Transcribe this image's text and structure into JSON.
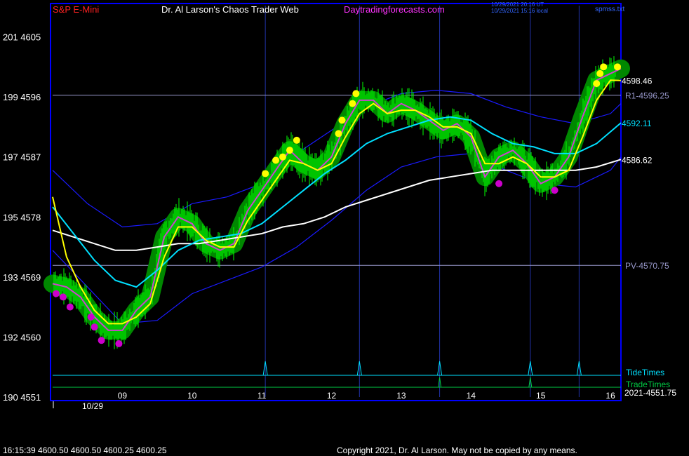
{
  "header": {
    "symbol": "S&P E-Mini",
    "site": "Dr. Al Larson's Chaos Trader Web",
    "url": "Daytradingforecasts.com",
    "utc_time": "10/29/2021 20:16 UT",
    "local_time": "10/29/2021 15:16 local",
    "file": "spmss.txt"
  },
  "footer": {
    "quote": "16:15:39  4600.50 4600.50 4600.25 4600.25",
    "copyright": "Copyright 2021, Dr. Al Larson. May not be copied by any means."
  },
  "colors": {
    "background": "#000000",
    "frame": "#0000ff",
    "price_bars": "#00ff00",
    "highlight": "#008800",
    "fast_ma": "#ffff00",
    "inner_line": "#cc44cc",
    "cyan_ma": "#00e0ff",
    "white_ma": "#ffffff",
    "band": "#1a1aff",
    "tide": "#00e0ff",
    "trade": "#00cc44",
    "level_line": "#9999cc",
    "yellow_dot": "#ffff00",
    "magenta_dot": "#cc00cc"
  },
  "chart_data": {
    "type": "line",
    "title": "S&P E-Mini",
    "x_tick_labels": [
      "09",
      "10",
      "11",
      "12",
      "13",
      "14",
      "15",
      "16"
    ],
    "date_label": "10/29",
    "y_axis": {
      "range": [
        4551,
        4610
      ],
      "ticks": [
        {
          "label": "201  4605",
          "value": 4605
        },
        {
          "label": "199  4596",
          "value": 4596
        },
        {
          "label": "197  4587",
          "value": 4587
        },
        {
          "label": "195  4578",
          "value": 4578
        },
        {
          "label": "193  4569",
          "value": 4569
        },
        {
          "label": "192  4560",
          "value": 4560
        },
        {
          "label": "190  4551",
          "value": 4551
        }
      ]
    },
    "levels": [
      {
        "label": "R1-4596.25",
        "value": 4596.25
      },
      {
        "label": "PV-4570.75",
        "value": 4570.75
      }
    ],
    "right_labels": [
      {
        "text": "4598.46",
        "value": 4598.46,
        "color": "#ffffff"
      },
      {
        "text": "4592.11",
        "value": 4592.11,
        "color": "#00e0ff"
      },
      {
        "text": "4586.62",
        "value": 4586.62,
        "color": "#ffffff"
      }
    ],
    "bottom_right_label": "2021-4551.75",
    "tide_times_label": "TideTimes",
    "trade_times_label": "TradeTimes",
    "tide_times": [
      11.05,
      12.4,
      13.55,
      14.85,
      15.55
    ],
    "trade_times": [
      13.55,
      14.85
    ],
    "series": [
      {
        "role": "price",
        "x": [
          8.0,
          8.2,
          8.4,
          8.6,
          8.8,
          9.0,
          9.2,
          9.4,
          9.6,
          9.8,
          10.0,
          10.2,
          10.4,
          10.6,
          10.8,
          11.0,
          11.2,
          11.4,
          11.6,
          11.8,
          12.0,
          12.2,
          12.4,
          12.6,
          12.8,
          13.0,
          13.2,
          13.4,
          13.6,
          13.8,
          14.0,
          14.2,
          14.4,
          14.6,
          14.8,
          15.0,
          15.2,
          15.4,
          15.6,
          15.8,
          16.0,
          16.15
        ],
        "values": [
          4568.0,
          4567.5,
          4566.0,
          4563.0,
          4561.0,
          4561.0,
          4564.0,
          4566.0,
          4575.0,
          4578.0,
          4577.0,
          4574.0,
          4573.0,
          4574.0,
          4579.0,
          4582.0,
          4585.0,
          4588.0,
          4586.0,
          4585.0,
          4587.0,
          4592.0,
          4595.5,
          4595.5,
          4593.5,
          4595.0,
          4594.0,
          4592.5,
          4591.0,
          4592.0,
          4590.0,
          4584.0,
          4587.0,
          4588.0,
          4586.0,
          4583.0,
          4584.0,
          4587.0,
          4593.0,
          4598.5,
          4599.5,
          4600.25
        ]
      },
      {
        "role": "fast_ma",
        "x": [
          8.0,
          8.2,
          8.4,
          8.6,
          8.8,
          9.0,
          9.2,
          9.4,
          9.6,
          9.8,
          10.0,
          10.2,
          10.4,
          10.6,
          10.8,
          11.0,
          11.2,
          11.4,
          11.6,
          11.8,
          12.0,
          12.2,
          12.4,
          12.6,
          12.8,
          13.0,
          13.2,
          13.4,
          13.6,
          13.8,
          14.0,
          14.2,
          14.4,
          14.6,
          14.8,
          15.0,
          15.2,
          15.4,
          15.6,
          15.8,
          16.0,
          16.15
        ],
        "values": [
          4581.0,
          4572.0,
          4567.5,
          4564.0,
          4562.0,
          4562.0,
          4563.0,
          4565.0,
          4572.0,
          4576.5,
          4576.5,
          4574.5,
          4573.5,
          4573.5,
          4577.5,
          4580.5,
          4583.5,
          4586.5,
          4586.0,
          4585.0,
          4586.0,
          4590.0,
          4593.5,
          4595.0,
          4593.5,
          4594.0,
          4594.0,
          4593.0,
          4591.5,
          4591.5,
          4590.5,
          4586.0,
          4586.0,
          4587.0,
          4586.0,
          4584.0,
          4584.0,
          4585.0,
          4590.0,
          4595.5,
          4598.5,
          4598.46
        ]
      },
      {
        "role": "cyan_ma",
        "x": [
          8.0,
          8.3,
          8.6,
          8.9,
          9.2,
          9.5,
          9.8,
          10.1,
          10.4,
          10.7,
          11.0,
          11.3,
          11.6,
          11.9,
          12.2,
          12.5,
          12.8,
          13.1,
          13.4,
          13.7,
          14.0,
          14.3,
          14.6,
          14.9,
          15.2,
          15.5,
          15.8,
          16.15
        ],
        "values": [
          4579.5,
          4575.5,
          4571.5,
          4568.5,
          4567.5,
          4570.0,
          4573.0,
          4574.5,
          4575.0,
          4575.5,
          4577.0,
          4579.5,
          4582.0,
          4584.5,
          4586.5,
          4589.0,
          4590.5,
          4591.5,
          4592.5,
          4593.0,
          4592.5,
          4590.5,
          4589.0,
          4588.5,
          4587.5,
          4587.5,
          4589.0,
          4592.11
        ]
      },
      {
        "role": "white_ma",
        "x": [
          8.0,
          8.3,
          8.6,
          8.9,
          9.2,
          9.5,
          9.8,
          10.1,
          10.4,
          10.7,
          11.0,
          11.3,
          11.6,
          11.9,
          12.2,
          12.5,
          12.8,
          13.1,
          13.4,
          13.7,
          14.0,
          14.3,
          14.6,
          14.9,
          15.2,
          15.5,
          15.8,
          16.15
        ],
        "values": [
          4576.0,
          4575.0,
          4574.0,
          4573.0,
          4573.0,
          4573.5,
          4574.0,
          4574.0,
          4574.5,
          4575.0,
          4575.5,
          4576.5,
          4577.0,
          4578.0,
          4579.5,
          4580.5,
          4581.5,
          4582.5,
          4583.5,
          4584.0,
          4584.5,
          4585.0,
          4585.0,
          4585.0,
          4585.0,
          4585.0,
          4585.5,
          4586.62
        ]
      },
      {
        "role": "upper_band",
        "x": [
          8.0,
          8.5,
          9.0,
          9.5,
          10.0,
          10.5,
          11.0,
          11.5,
          12.0,
          12.5,
          13.0,
          13.5,
          14.0,
          14.5,
          15.0,
          15.5,
          16.0,
          16.15
        ],
        "values": [
          4585.0,
          4580.0,
          4576.5,
          4577.0,
          4580.0,
          4581.0,
          4583.0,
          4587.5,
          4591.0,
          4594.5,
          4596.5,
          4597.0,
          4596.5,
          4594.5,
          4593.0,
          4592.0,
          4593.5,
          4595.0
        ]
      },
      {
        "role": "lower_band",
        "x": [
          8.0,
          8.5,
          9.0,
          9.5,
          10.0,
          10.5,
          11.0,
          11.5,
          12.0,
          12.5,
          13.0,
          13.5,
          14.0,
          14.5,
          15.0,
          15.5,
          16.0,
          16.15
        ],
        "values": [
          4573.0,
          4567.5,
          4562.0,
          4562.5,
          4566.5,
          4568.5,
          4570.5,
          4573.5,
          4577.5,
          4582.0,
          4585.5,
          4587.0,
          4587.5,
          4585.0,
          4583.0,
          4582.5,
          4585.0,
          4587.0
        ]
      }
    ],
    "yellow_dots": [
      {
        "x": 11.05,
        "y": 4584.5
      },
      {
        "x": 11.2,
        "y": 4586.5
      },
      {
        "x": 11.3,
        "y": 4587.0
      },
      {
        "x": 11.4,
        "y": 4588.0
      },
      {
        "x": 11.5,
        "y": 4589.5
      },
      {
        "x": 12.1,
        "y": 4590.5
      },
      {
        "x": 12.15,
        "y": 4592.5
      },
      {
        "x": 12.3,
        "y": 4595.0
      },
      {
        "x": 12.35,
        "y": 4596.5
      },
      {
        "x": 15.8,
        "y": 4598.0
      },
      {
        "x": 15.85,
        "y": 4599.5
      },
      {
        "x": 15.9,
        "y": 4600.5
      },
      {
        "x": 16.1,
        "y": 4600.5
      }
    ],
    "magenta_dots": [
      {
        "x": 8.05,
        "y": 4566.5
      },
      {
        "x": 8.15,
        "y": 4566.0
      },
      {
        "x": 8.25,
        "y": 4564.5
      },
      {
        "x": 8.55,
        "y": 4563.0
      },
      {
        "x": 8.6,
        "y": 4561.5
      },
      {
        "x": 8.7,
        "y": 4559.5
      },
      {
        "x": 8.95,
        "y": 4559.0
      },
      {
        "x": 14.4,
        "y": 4583.0
      },
      {
        "x": 15.2,
        "y": 4582.0
      }
    ]
  }
}
